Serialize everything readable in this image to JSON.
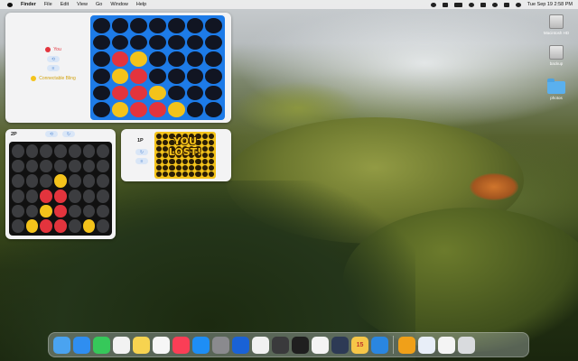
{
  "menubar": {
    "app_name": "Finder",
    "menus": [
      "File",
      "Edit",
      "View",
      "Go",
      "Window",
      "Help"
    ],
    "datetime": "Tue Sep 19  2:58 PM"
  },
  "widget_large": {
    "player_label": "You",
    "opponent_label": "Connectable Bling",
    "board": [
      [
        "e",
        "e",
        "e",
        "e",
        "e",
        "e",
        "e"
      ],
      [
        "e",
        "e",
        "e",
        "e",
        "e",
        "e",
        "e"
      ],
      [
        "e",
        "r",
        "y",
        "e",
        "e",
        "e",
        "e"
      ],
      [
        "e",
        "y",
        "r",
        "e",
        "e",
        "e",
        "e"
      ],
      [
        "e",
        "r",
        "r",
        "y",
        "e",
        "e",
        "e"
      ],
      [
        "e",
        "y",
        "r",
        "r",
        "y",
        "e",
        "e"
      ]
    ]
  },
  "widget_2p": {
    "label": "2P",
    "board": [
      [
        "e",
        "e",
        "e",
        "e",
        "e",
        "e",
        "e"
      ],
      [
        "e",
        "e",
        "e",
        "e",
        "e",
        "e",
        "e"
      ],
      [
        "e",
        "e",
        "e",
        "y",
        "e",
        "e",
        "e"
      ],
      [
        "e",
        "e",
        "r",
        "r",
        "e",
        "e",
        "e"
      ],
      [
        "e",
        "e",
        "y",
        "r",
        "e",
        "e",
        "e"
      ],
      [
        "e",
        "y",
        "r",
        "r",
        "e",
        "y",
        "e"
      ]
    ]
  },
  "widget_1p": {
    "label": "1P",
    "result_line1": "YOU",
    "result_line2": "LOST!"
  },
  "desktop": {
    "items": [
      {
        "label": "Macintosh HD",
        "icon": "drive-icon"
      },
      {
        "label": "backup",
        "icon": "drive-icon"
      },
      {
        "label": "photos",
        "icon": "folder-icon"
      }
    ]
  },
  "dock": {
    "apps": [
      {
        "name": "Finder",
        "icon": "finder-icon",
        "color": "#4aa3f0"
      },
      {
        "name": "Safari",
        "icon": "safari-icon",
        "color": "#2f8ef0"
      },
      {
        "name": "Messages",
        "icon": "messages-icon",
        "color": "#36c85a"
      },
      {
        "name": "Reminders",
        "icon": "reminders-icon",
        "color": "#f2f2f2"
      },
      {
        "name": "Notes",
        "icon": "notes-icon",
        "color": "#f7d350"
      },
      {
        "name": "Freeform",
        "icon": "freeform-icon",
        "color": "#f6f6f6"
      },
      {
        "name": "Music",
        "icon": "music-icon",
        "color": "#fa3e56"
      },
      {
        "name": "App Store",
        "icon": "appstore-icon",
        "color": "#1e8ef5"
      },
      {
        "name": "System Settings",
        "icon": "settings-icon",
        "color": "#8a8a8e"
      },
      {
        "name": "1Password",
        "icon": "onepassword-icon",
        "color": "#1a62d6"
      },
      {
        "name": "Chrome",
        "icon": "chrome-icon",
        "color": "#f1f1f1"
      },
      {
        "name": "Calculator",
        "icon": "calculator-icon",
        "color": "#3a3a3c"
      },
      {
        "name": "Terminal",
        "icon": "terminal-icon",
        "color": "#1f1f1f"
      },
      {
        "name": "Slack",
        "icon": "slack-icon",
        "color": "#f4f4f4"
      },
      {
        "name": "Screen Sharing",
        "icon": "screen-icon",
        "color": "#2d3a55"
      },
      {
        "name": "Calendar",
        "icon": "calendar-icon",
        "color": "#f6c648",
        "text": "15"
      },
      {
        "name": "Xcode",
        "icon": "xcode-icon",
        "color": "#2a86e0"
      },
      {
        "name": "Connect Four",
        "icon": "connectfour-icon",
        "color": "#f0a019"
      },
      {
        "name": "1Password",
        "icon": "onepassword-icon",
        "color": "#e8eef8"
      },
      {
        "name": "Document",
        "icon": "document-icon",
        "color": "#f4f4f4"
      },
      {
        "name": "Trash",
        "icon": "trash-icon",
        "color": "#d9dbde"
      }
    ]
  }
}
